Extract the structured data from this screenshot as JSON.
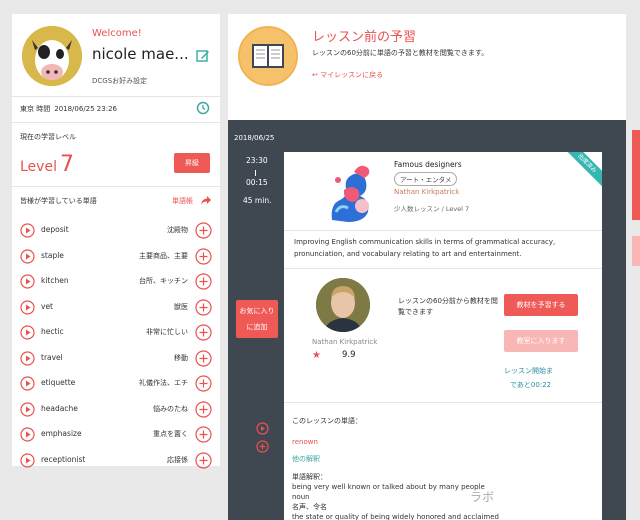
{
  "profile": {
    "welcome": "Welcome!",
    "name": "nicole mae...",
    "settings": "DCGSお好み設定"
  },
  "clock": {
    "label": "東京 時間",
    "datetime": "2018/06/25 23:26"
  },
  "level": {
    "label": "現在の学習レベル",
    "word": "Level",
    "number": "7",
    "upgrade": "昇級"
  },
  "words_section": {
    "title": "皆様が学習している単語",
    "wordbook": "単語帳"
  },
  "words": [
    {
      "en": "deposit",
      "jp": "沈殿物"
    },
    {
      "en": "staple",
      "jp": "主要商品、主要"
    },
    {
      "en": "kitchen",
      "jp": "台所、キッチン"
    },
    {
      "en": "vet",
      "jp": "獣医"
    },
    {
      "en": "hectic",
      "jp": "非常に忙しい"
    },
    {
      "en": "travel",
      "jp": "移動"
    },
    {
      "en": "etiquette",
      "jp": "礼儀作法、エチ"
    },
    {
      "en": "headache",
      "jp": "悩みのたね"
    },
    {
      "en": "emphasize",
      "jp": "重点を置く"
    },
    {
      "en": "receptionist",
      "jp": "応接係"
    }
  ],
  "header": {
    "title": "レッスン前の予習",
    "subtitle": "レッスンの60分前に単語の予習と教材を閲覧できます。",
    "back": "マイレッスンに戻る"
  },
  "lesson": {
    "date": "2018/06/25",
    "start": "23:30",
    "sep": "I",
    "end": "00:15",
    "duration": "45 min.",
    "favorite_line1": "お気に入り",
    "favorite_line2": "に追加",
    "ribbon": "出席済み",
    "course_title": "Famous designers",
    "category": "アート・エンタメ",
    "teacher": "Nathan Kirkpatrick",
    "meta": "少人数レッスン / Level 7",
    "description": "Improving English communication skills in terms of grammatical accuracy, pronunciation, and vocabulary relating to art and entertainment.",
    "teacher_name": "Nathan Kirkpatrick",
    "rating": "9.9",
    "notice": "レッスンの60分前から教材を閲覧できます",
    "reserve_btn": "教材を予習する",
    "enter_btn": "教室に入ります",
    "start_line1": "レッスン開始ま",
    "start_line2": "であと00:22",
    "vocab_title": "このレッスンの単語：",
    "vocab_word": "renown",
    "vocab_other": "他の解釈",
    "vocab_exp_label": "単語解釈：",
    "vocab_exp_1": "being very well known or talked about by many people",
    "vocab_exp_2": "noun",
    "vocab_exp_3": "名声、令名",
    "vocab_exp_4": "the state or quality of being widely honored and acclaimed"
  },
  "watermark": "ラボ",
  "colors": {
    "accent": "#e8524f",
    "dark": "#3f4850",
    "teal": "#35b7b0",
    "link": "#2b8fa1"
  }
}
